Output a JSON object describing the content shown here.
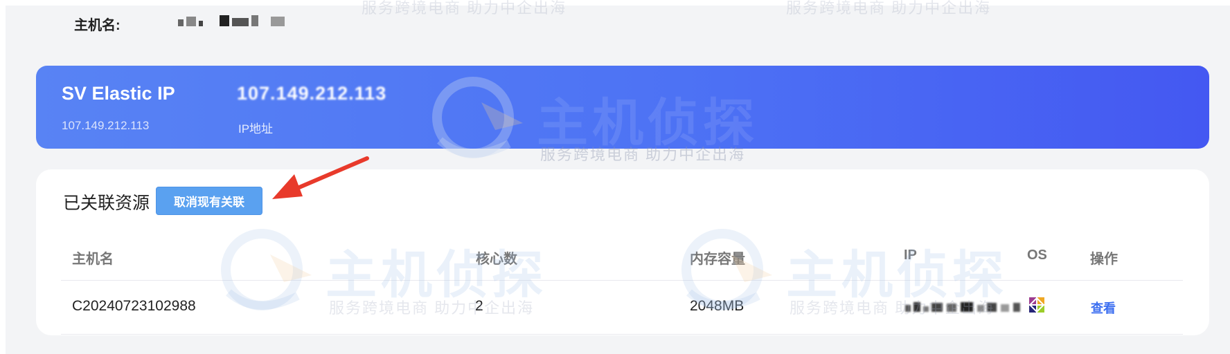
{
  "host": {
    "label": "主机名:"
  },
  "banner": {
    "title": "SV Elastic IP",
    "ip_value": "107.149.212.113",
    "ip_small": "107.149.212.113",
    "ip_label": "IP地址",
    "gradient_start": "#5883f4",
    "gradient_end": "#4458f2"
  },
  "resources": {
    "section_title": "已关联资源",
    "unlink_button": "取消现有关联",
    "button_color": "#5aa1f0",
    "columns": [
      "主机名",
      "核心数",
      "内存容量",
      "IP",
      "OS",
      "操作"
    ],
    "rows": [
      {
        "hostname": "C20240723102988",
        "cores": "2",
        "memory": "2048MB",
        "ip": "107.176.86.100",
        "os_icon": "centos-icon",
        "action": "查看"
      }
    ],
    "link_color": "#3b6ef0"
  },
  "watermark": {
    "brand": "主机侦探",
    "slogan": "服务跨境电商  助力中企出海"
  },
  "annotation": {
    "arrow_color": "#e83a2b"
  }
}
